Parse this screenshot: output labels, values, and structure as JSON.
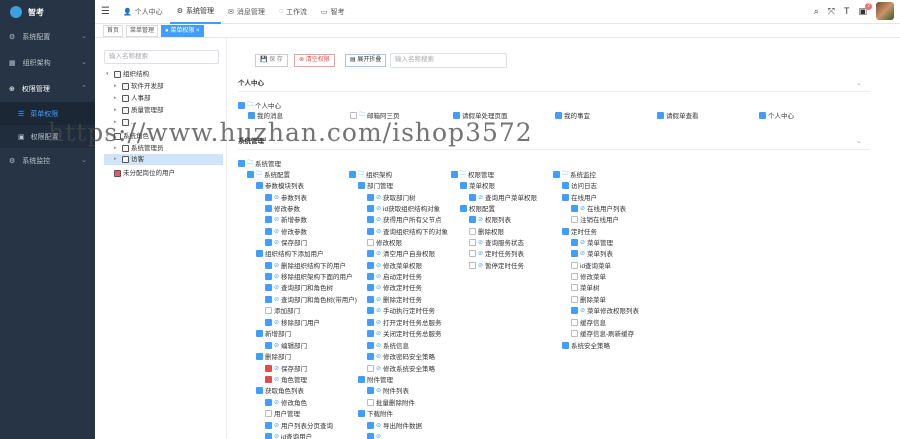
{
  "app": {
    "title": "智考"
  },
  "sidebar": {
    "items": [
      {
        "label": "系统配置"
      },
      {
        "label": "组织架构"
      },
      {
        "label": "权限管理"
      },
      {
        "label": "菜单权限"
      },
      {
        "label": "权限配置"
      },
      {
        "label": "系统监控"
      }
    ]
  },
  "topnav": {
    "items": [
      "个人中心",
      "系统管理",
      "消息管理",
      "工作流",
      "智考"
    ]
  },
  "header": {
    "notify_count": "2"
  },
  "tags": [
    "首页",
    "菜单管理",
    "菜单权限"
  ],
  "tree": {
    "search_placeholder": "输入名称搜索",
    "nodes": [
      "组织结构",
      "软件开发部",
      "人事部",
      "质量管理部",
      "...",
      "系统角色",
      "系统管理员",
      "访客",
      "未分配岗位的用户"
    ]
  },
  "toolbar": {
    "save": "保 存",
    "clear": "清空权限",
    "expand": "展开折叠",
    "search_placeholder": "输入名称搜索"
  },
  "sections": {
    "personal": "个人中心",
    "system": "系统管理"
  },
  "watermark": "https://www.huzhan.com/ishop3572",
  "perms": [
    "个人中心",
    "我的消息",
    "邮箱阿三页",
    "请假单处理页面",
    "我的事宜",
    "请假单查看",
    "个人中心",
    "系统管理",
    "系统配置",
    "组织架构",
    "权限管理",
    "系统监控",
    "参数模块列表",
    "部门管理",
    "菜单权限",
    "访问日志",
    "参数列表",
    "获取部门树",
    "查询用户菜单权限",
    "在线用户",
    "修改参数",
    "id获取组织结构对象",
    "权限配置",
    "在线用户列表",
    "新增参数",
    "获得用户所有父节点",
    "权限列表",
    "注销在线用户",
    "修改参数",
    "查询组织结构下的对象",
    "删除权限",
    "定时任务",
    "保存部门",
    "修改权限",
    "查询服务状态",
    "菜单管理",
    "组织结构下添加用户",
    "清空用户自身权限",
    "定时任务列表",
    "菜单列表",
    "删除组织结构下的用户",
    "修改菜单权限",
    "暂停定时任务",
    "id查询菜单",
    "移除组织架构下面的用户",
    "启动定时任务",
    "修改菜单",
    "查询部门和角色树",
    "修改定时任务",
    "菜单树",
    "查询部门和角色树(带用户)",
    "删除定时任务",
    "删除菜单",
    "添加部门",
    "手动执行定时任务",
    "菜单修改权限列表",
    "移除部门用户",
    "打开定时任务总服务",
    "缓存信息",
    "新增部门",
    "关闭定时任务总服务",
    "缓存信息-刷新缓存",
    "编辑部门",
    "系统信息",
    "系统安全策略",
    "删除部门",
    "修改密码安全策略",
    "保存部门",
    "修改系统安全策略",
    "角色管理",
    "附件管理",
    "获取角色列表",
    "附件列表",
    "修改角色",
    "批量删除附件",
    "用户管理",
    "下载附件",
    "用户列表分页查询",
    "导出附件数据",
    "id查询用户"
  ]
}
